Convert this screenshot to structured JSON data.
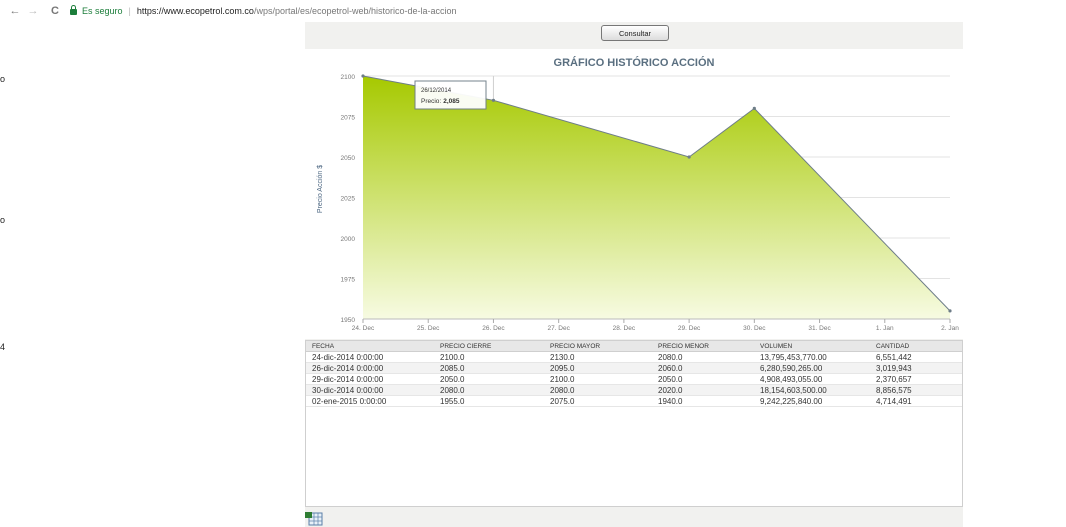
{
  "browser": {
    "back": "←",
    "forward": "→",
    "reload": "C",
    "secure_label": "Es seguro",
    "separator": "|",
    "url_host": "https://www.ecopetrol.com.co",
    "url_path": "/wps/portal/es/ecopetrol-web/historico-de-la-accion"
  },
  "page": {
    "consultar_label": "Consultar"
  },
  "chart_data": {
    "type": "area",
    "title": "GRÁFICO HISTÓRICO ACCIÓN",
    "ylabel": "Precio Acción $",
    "xlabel": "",
    "ylim": [
      1950,
      2100
    ],
    "y_ticks": [
      1950,
      1975,
      2000,
      2025,
      2050,
      2075,
      2100
    ],
    "x_ticks": [
      "24. Dec",
      "25. Dec",
      "26. Dec",
      "27. Dec",
      "28. Dec",
      "29. Dec",
      "30. Dec",
      "31. Dec",
      "1. Jan",
      "2. Jan"
    ],
    "series": [
      {
        "x": [
          0,
          2,
          5,
          6,
          9
        ],
        "values": [
          2100,
          2085,
          2050,
          2080,
          1955
        ]
      }
    ],
    "colors": {
      "fill_top": "#a6c900",
      "fill_bottom": "#f7fbe2",
      "line": "#6e7d88"
    },
    "grid": true,
    "tooltip": {
      "date": "26/12/2014",
      "label": "Precio:",
      "value": "2,085"
    }
  },
  "table": {
    "columns": [
      "FECHA",
      "PRECIO CIERRE",
      "PRECIO MAYOR",
      "PRECIO MENOR",
      "VOLUMEN",
      "CANTIDAD"
    ],
    "rows": [
      [
        "24-dic-2014 0:00:00",
        "2100.0",
        "2130.0",
        "2080.0",
        "13,795,453,770.00",
        "6,551,442"
      ],
      [
        "26-dic-2014 0:00:00",
        "2085.0",
        "2095.0",
        "2060.0",
        "6,280,590,265.00",
        "3,019,943"
      ],
      [
        "29-dic-2014 0:00:00",
        "2050.0",
        "2100.0",
        "2050.0",
        "4,908,493,055.00",
        "2,370,657"
      ],
      [
        "30-dic-2014 0:00:00",
        "2080.0",
        "2080.0",
        "2020.0",
        "18,154,603,500.00",
        "8,856,575"
      ],
      [
        "02-ene-2015 0:00:00",
        "1955.0",
        "2075.0",
        "1940.0",
        "9,242,225,840.00",
        "4,714,491"
      ]
    ]
  },
  "edge_marks": [
    "o",
    "o",
    "4"
  ]
}
